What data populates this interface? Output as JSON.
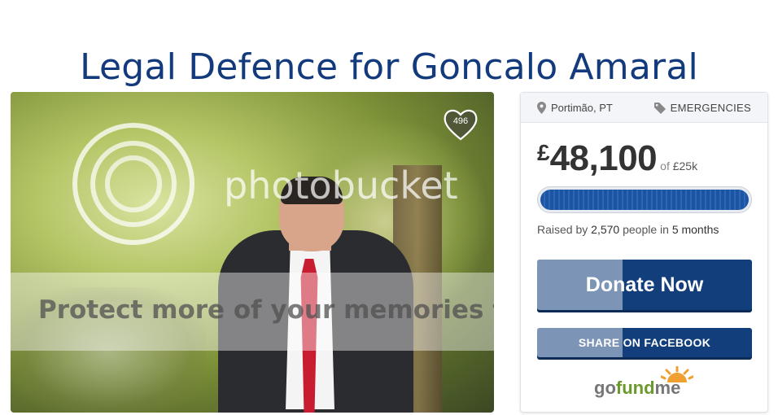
{
  "page": {
    "title": "Legal Defence for Goncalo Amaral"
  },
  "photo": {
    "watermark_text": "Protect more of your memories for less!",
    "watermark_brand": "photobucket",
    "heart_count": "496"
  },
  "card": {
    "location": "Portimão, PT",
    "category": "EMERGENCIES",
    "currency": "£",
    "amount": "48,100",
    "goal_prefix": "of",
    "goal": "£25k",
    "progress_fraction": 1.0,
    "raised_prefix": "Raised by",
    "raised_count": "2,570",
    "raised_mid": "people in",
    "raised_duration": "5 months",
    "donate_label": "Donate Now",
    "share_label": "SHARE ON FACEBOOK",
    "brand_go": "go",
    "brand_fund": "fund",
    "brand_me": "me"
  },
  "colors": {
    "title": "#123a7c",
    "button": "#123f7c",
    "progress": "#1d55a3"
  },
  "icons": [
    "map-pin-icon",
    "tag-icon",
    "heart-icon",
    "gofundme-sun-icon"
  ]
}
